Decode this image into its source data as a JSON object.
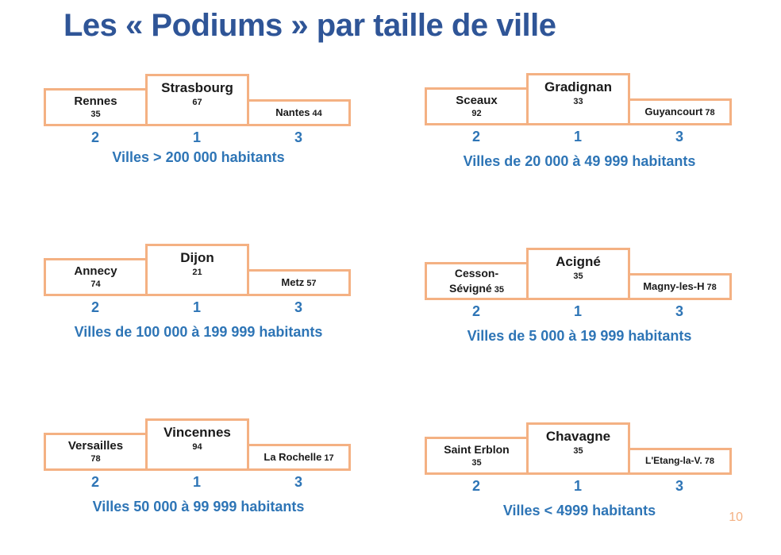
{
  "title": "Les « Podiums » par taille de ville",
  "page_number": "10",
  "podiums": [
    {
      "first": {
        "name": "Strasbourg",
        "code": "67"
      },
      "second": {
        "name": "Rennes",
        "code": "35"
      },
      "third": {
        "name": "Nantes",
        "code": "44"
      },
      "ranks": {
        "second": "2",
        "first": "1",
        "third": "3"
      },
      "caption": "Villes > 200 000 habitants"
    },
    {
      "first": {
        "name": "Gradignan",
        "code": "33"
      },
      "second": {
        "name": "Sceaux",
        "code": "92"
      },
      "third": {
        "name": "Guyancourt",
        "code": "78"
      },
      "ranks": {
        "second": "2",
        "first": "1",
        "third": "3"
      },
      "caption": "Villes de 20 000 à 49 999 habitants"
    },
    {
      "first": {
        "name": "Dijon",
        "code": "21"
      },
      "second": {
        "name": "Annecy",
        "code": "74"
      },
      "third": {
        "name": "Metz",
        "code": "57"
      },
      "ranks": {
        "second": "2",
        "first": "1",
        "third": "3"
      },
      "caption": "Villes de 100 000 à 199 999 habitants"
    },
    {
      "first": {
        "name": "Acigné",
        "code": "35"
      },
      "second": {
        "name_line1": "Cesson-",
        "name_line2": "Sévigné",
        "code": "35"
      },
      "third": {
        "name": "Magny-les-H",
        "code": "78"
      },
      "ranks": {
        "second": "2",
        "first": "1",
        "third": "3"
      },
      "caption": "Villes de 5 000 à 19 999 habitants"
    },
    {
      "first": {
        "name": "Vincennes",
        "code": "94"
      },
      "second": {
        "name": "Versailles",
        "code": "78"
      },
      "third": {
        "name": "La Rochelle",
        "code": "17"
      },
      "ranks": {
        "second": "2",
        "first": "1",
        "third": "3"
      },
      "caption": "Villes 50 000 à 99 999 habitants"
    },
    {
      "first": {
        "name": "Chavagne",
        "code": "35"
      },
      "second": {
        "name": "Saint Erblon",
        "code": "35"
      },
      "third": {
        "name": "L'Etang-la-V.",
        "code": "78"
      },
      "ranks": {
        "second": "2",
        "first": "1",
        "third": "3"
      },
      "caption": "Villes < 4999 habitants"
    }
  ]
}
